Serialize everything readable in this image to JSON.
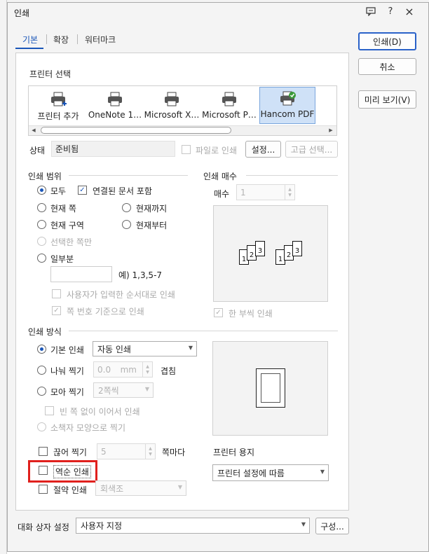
{
  "window": {
    "title": "인쇄",
    "help": "?",
    "close": "×"
  },
  "tabs": [
    {
      "label": "기본"
    },
    {
      "label": "확장"
    },
    {
      "label": "워터마크"
    }
  ],
  "buttons": {
    "print": "인쇄(D)",
    "cancel": "취소",
    "preview": "미리 보기(V)"
  },
  "printer": {
    "section": "프린터 선택",
    "items": [
      {
        "label": "프린터 추가"
      },
      {
        "label": "OneNote 1…"
      },
      {
        "label": "Microsoft X…"
      },
      {
        "label": "Microsoft P…"
      },
      {
        "label": "Hancom PDF"
      }
    ],
    "status_label": "상태",
    "status_value": "준비됨",
    "print_to_file": "파일로 인쇄",
    "settings": "설정...",
    "advanced": "고급 선택..."
  },
  "range": {
    "section": "인쇄 범위",
    "all": "모두",
    "include_linked": "연결된 문서 포함",
    "current_page": "현재 쪽",
    "until_current": "현재까지",
    "current_section": "현재 구역",
    "from_current": "현재부터",
    "selected_pages": "선택한 쪽만",
    "some": "일부분",
    "example": "예) 1,3,5-7",
    "user_order": "사용자가 입력한 순서대로 인쇄",
    "page_number_basis": "쪽 번호 기준으로 인쇄"
  },
  "copies": {
    "section": "인쇄 매수",
    "label": "매수",
    "value": "1",
    "collate": "한 부씩 인쇄",
    "collate_pages": [
      "1",
      "2",
      "3"
    ]
  },
  "method": {
    "section": "인쇄 방식",
    "basic": "기본 인쇄",
    "basic_option": "자동 인쇄",
    "split": "나눠 찍기",
    "split_value": "0.0",
    "split_unit": "mm",
    "overlap": "겹침",
    "gather": "모아 찍기",
    "gather_value": "2쪽씩",
    "no_blank": "빈 쪽 없이 이어서 인쇄",
    "booklet": "소책자 모양으로 찍기",
    "cut": "끊어 찍기",
    "cut_value": "5",
    "cut_unit": "쪽마다",
    "reverse": "역순 인쇄",
    "saving": "절약 인쇄",
    "saving_value": "회색조"
  },
  "paper": {
    "label": "프린터 용지",
    "value": "프린터 설정에 따름"
  },
  "footer": {
    "label": "대화 상자 설정",
    "value": "사용자 지정",
    "configure": "구성..."
  },
  "colors": {
    "accent": "#1a56b8",
    "highlight": "#e0201d",
    "selected_printer": "#cfe1f7"
  }
}
